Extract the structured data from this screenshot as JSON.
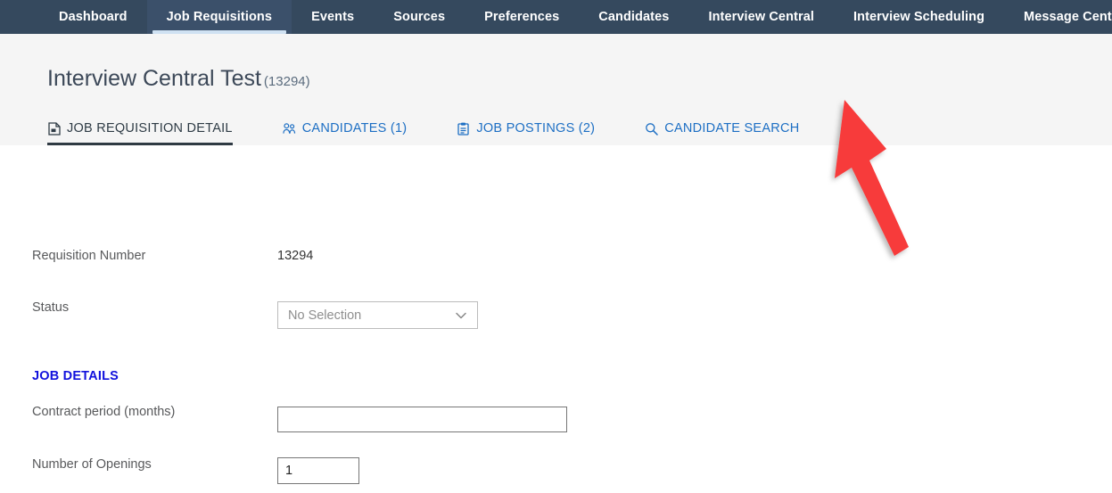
{
  "topnav": {
    "items": [
      {
        "label": "Dashboard",
        "active": false
      },
      {
        "label": "Job Requisitions",
        "active": true
      },
      {
        "label": "Events",
        "active": false
      },
      {
        "label": "Sources",
        "active": false
      },
      {
        "label": "Preferences",
        "active": false
      },
      {
        "label": "Candidates",
        "active": false
      },
      {
        "label": "Interview Central",
        "active": false
      },
      {
        "label": "Interview Scheduling",
        "active": false
      },
      {
        "label": "Message Center",
        "active": false
      }
    ],
    "background_color": "#35495e",
    "active_underline_color": "#cfe1f2"
  },
  "header": {
    "title": "Interview Central Test",
    "requisition_id": "(13294)",
    "background_color": "#f5f5f5"
  },
  "tabs": [
    {
      "label": "JOB REQUISITION DETAIL",
      "icon": "document-icon",
      "active": true
    },
    {
      "label": "CANDIDATES (1)",
      "icon": "people-icon",
      "active": false
    },
    {
      "label": "JOB POSTINGS (2)",
      "icon": "clipboard-icon",
      "active": false
    },
    {
      "label": "CANDIDATE SEARCH",
      "icon": "search-icon",
      "active": false
    }
  ],
  "form": {
    "requisition_number": {
      "label": "Requisition Number",
      "value": "13294"
    },
    "status": {
      "label": "Status",
      "selected": "No Selection"
    },
    "section_job_details": "JOB DETAILS",
    "contract_period": {
      "label": "Contract period (months)",
      "value": "",
      "placeholder": ""
    },
    "number_of_openings": {
      "label": "Number of Openings",
      "value": "1",
      "placeholder": ""
    }
  },
  "annotation": {
    "arrow_color": "#f73b3b",
    "description": "red-arrow-pointing-up-left"
  }
}
